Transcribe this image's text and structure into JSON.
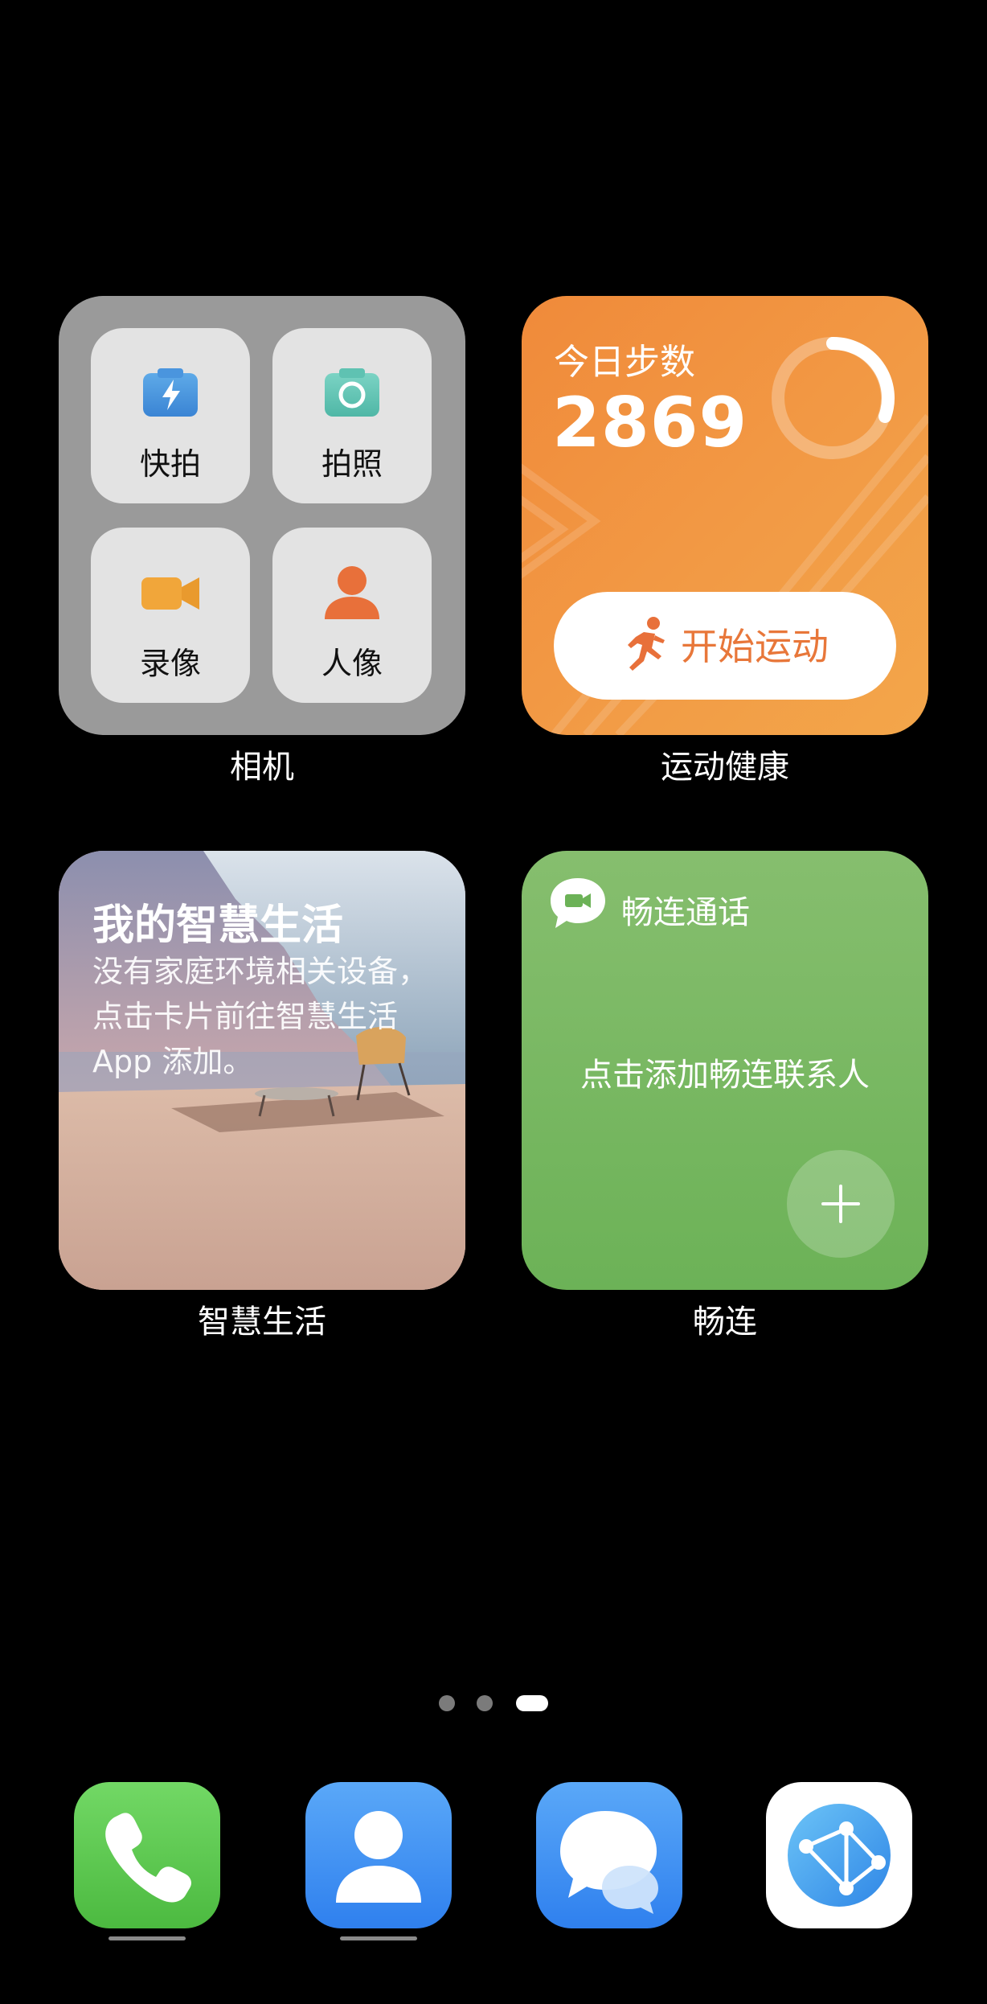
{
  "camera_widget": {
    "label": "相机",
    "tiles": [
      "快拍",
      "拍照",
      "录像",
      "人像"
    ]
  },
  "health_widget": {
    "label": "运动健康",
    "title": "今日步数",
    "steps": "2869",
    "button_label": "开始运动"
  },
  "smart_life_widget": {
    "label": "智慧生活",
    "title": "我的智慧生活",
    "description": "没有家庭环境相关设备，点击卡片前往智慧生活 App 添加。"
  },
  "changlian_widget": {
    "label": "畅连",
    "title": "畅连通话",
    "prompt": "点击添加畅连联系人"
  },
  "page_indicator": {
    "total": 3,
    "active_index": 2
  },
  "dock": {
    "apps": [
      {
        "icon": "phone-icon",
        "color": "#5fcb52",
        "has_underline": true
      },
      {
        "icon": "contacts-icon",
        "color": "#3f8ff3",
        "has_underline": true
      },
      {
        "icon": "messages-icon",
        "color": "#3f8ff3",
        "has_underline": false
      },
      {
        "icon": "browser-icon",
        "color": "#ffffff",
        "has_underline": false
      }
    ]
  },
  "colors": {
    "health_orange": "#f08a3a",
    "changlian_green": "#6cb257",
    "camera_gray": "#9a9a9a"
  }
}
